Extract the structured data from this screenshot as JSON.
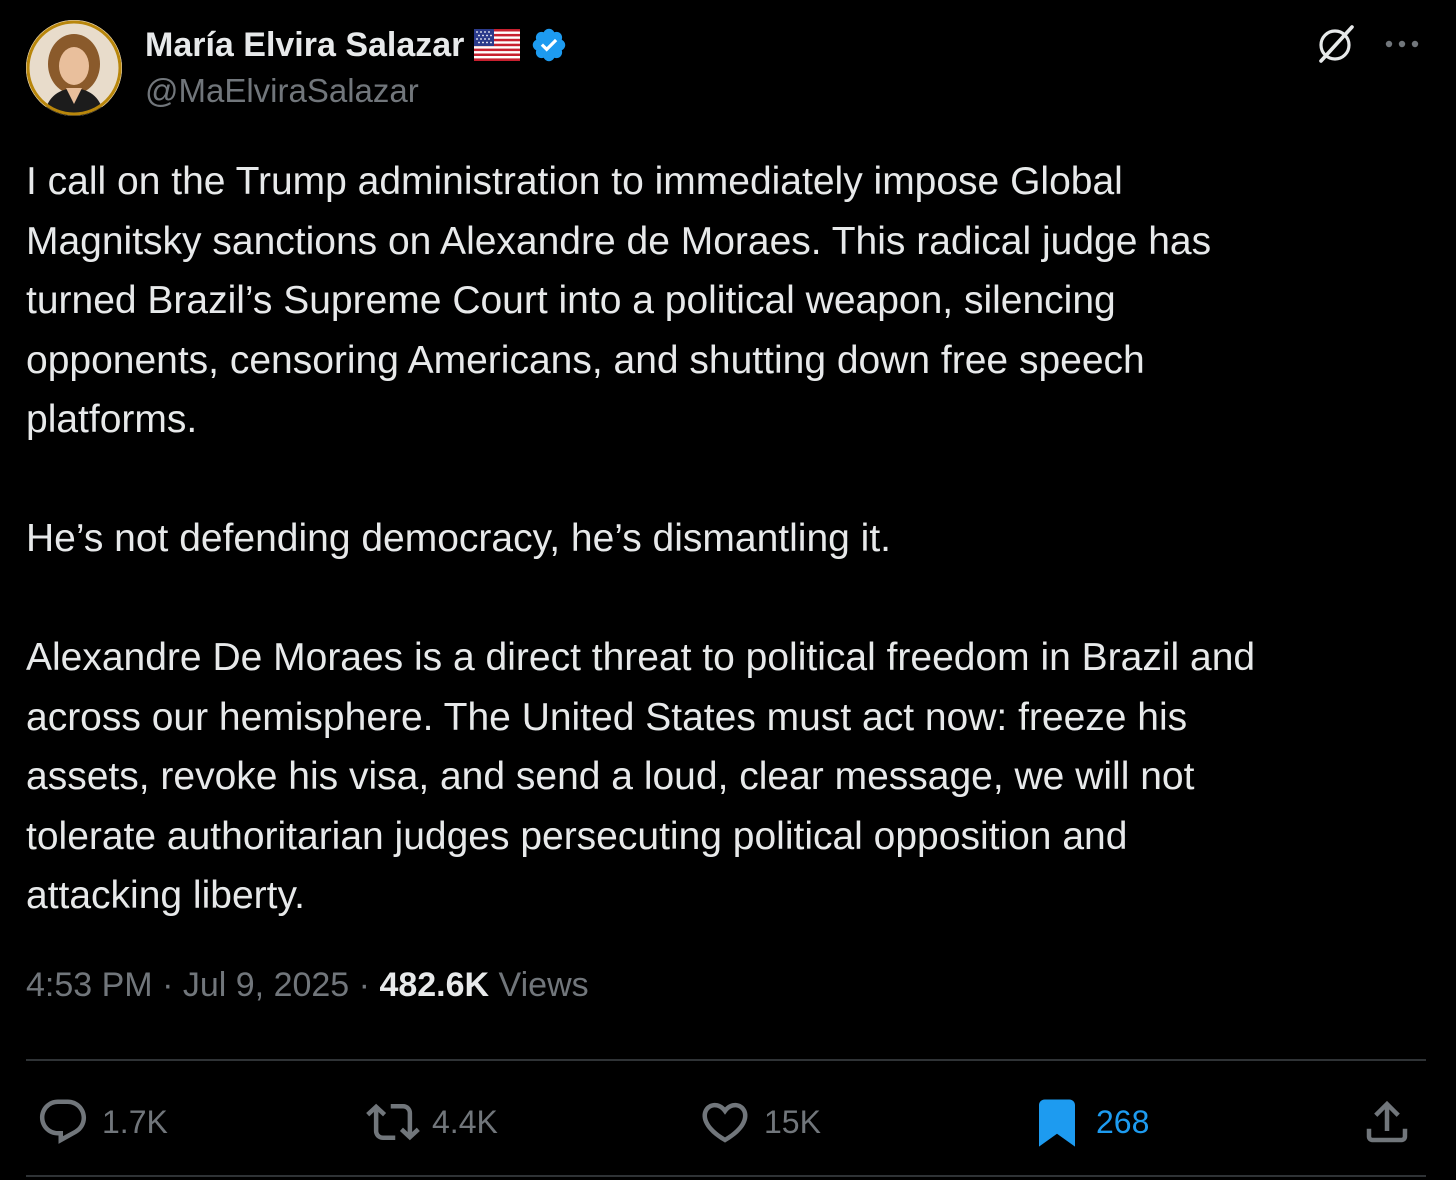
{
  "author": {
    "display_name": "María Elvira Salazar",
    "handle": "@MaElviraSalazar",
    "flag_icon": "us-flag-icon",
    "verified_icon": "verified-badge-icon",
    "verified_color": "#1d9bf0"
  },
  "header_actions": {
    "grok_icon": "grok-icon",
    "more_icon": "more-options-icon"
  },
  "tweet": {
    "paragraphs": [
      {
        "lines": [
          "I call on the Trump administration to immediately impose Global",
          "Magnitsky sanctions on Alexandre de Moraes. This radical judge has",
          "turned Brazil’s Supreme Court into a political weapon, silencing",
          "opponents, censoring Americans, and shutting down free speech",
          "platforms."
        ]
      },
      {
        "lines": [
          "He’s not defending democracy, he’s dismantling it."
        ]
      },
      {
        "lines": [
          "Alexandre De Moraes is a direct threat to political freedom in Brazil and",
          "across our hemisphere. The United States must act now: freeze his",
          "assets, revoke his visa, and send a loud, clear message, we will not",
          "tolerate authoritarian judges persecuting political opposition and",
          "attacking liberty."
        ]
      }
    ]
  },
  "meta": {
    "time": "4:53 PM",
    "separator": "·",
    "date": "Jul 9, 2025",
    "views_count": "482.6K",
    "views_label": "Views"
  },
  "actions": {
    "reply": {
      "icon": "reply-icon",
      "count": "1.7K"
    },
    "retweet": {
      "icon": "retweet-icon",
      "count": "4.4K"
    },
    "like": {
      "icon": "heart-icon",
      "count": "15K"
    },
    "bookmark": {
      "icon": "bookmark-icon",
      "count": "268",
      "active_color": "#1d9bf0"
    },
    "share": {
      "icon": "share-icon"
    }
  },
  "colors": {
    "background": "#000000",
    "text_primary": "#e7e9ea",
    "text_secondary": "#71767b",
    "accent": "#1d9bf0",
    "divider": "#2f3336"
  }
}
